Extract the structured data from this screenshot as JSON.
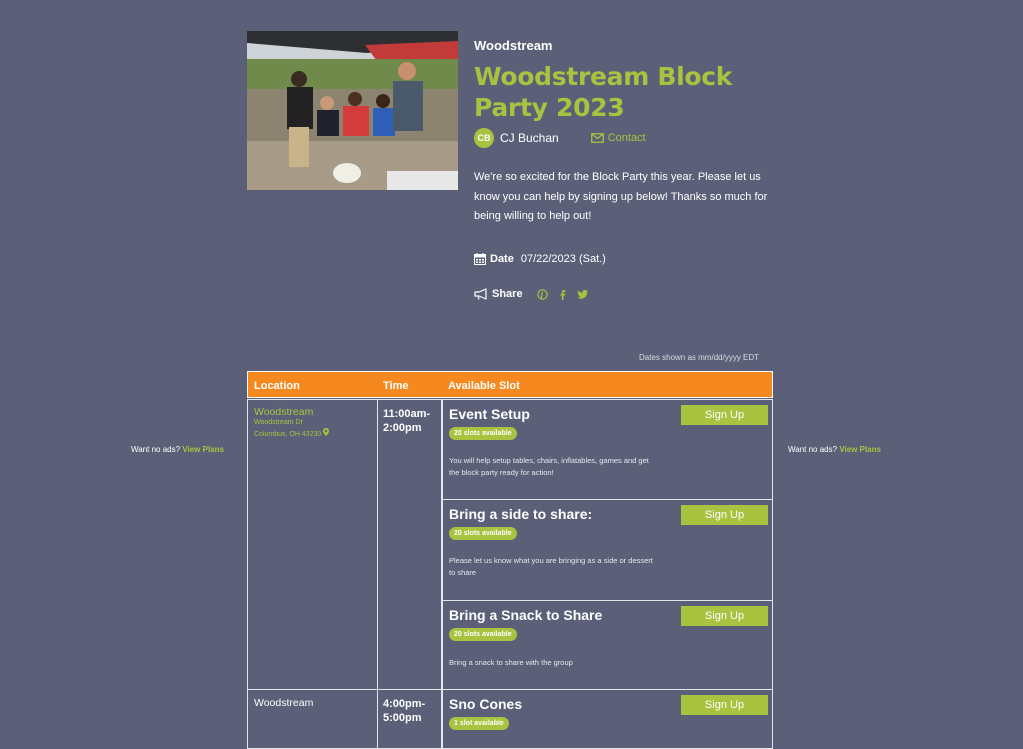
{
  "event": {
    "org": "Woodstream",
    "title": "Woodstream Block Party 2023",
    "organizer_initials": "CB",
    "organizer_name": "CJ Buchan",
    "contact_label": "Contact",
    "description": "We're so excited for the Block Party this year. Please let us know you can help by signing up below! Thanks so much for being willing to help out!",
    "date_label": "Date",
    "date_value": "07/22/2023 (Sat.)",
    "share_label": "Share",
    "share_icons": [
      "pinterest-icon",
      "facebook-icon",
      "twitter-icon"
    ]
  },
  "dates_note": "Dates shown as mm/dd/yyyy EDT",
  "ads": {
    "text": "Want no ads?",
    "link": "View Plans"
  },
  "table": {
    "headers": {
      "location": "Location",
      "time": "Time",
      "slot": "Available Slot"
    },
    "groups": [
      {
        "location": "Woodstream",
        "address1": "Woodstream Dr",
        "address2": "Columbus, OH 43230",
        "time": "11:00am-2:00pm",
        "slots": [
          {
            "title": "Event Setup",
            "badge": "20 slots available",
            "desc": "You will help setup tables, chairs, inflatables, games and get the block party ready for action!",
            "button": "Sign Up"
          },
          {
            "title": "Bring a side to share:",
            "badge": "20 slots available",
            "desc": "Please let us know what you are bringing as a side or dessert to share",
            "button": "Sign Up"
          },
          {
            "title": "Bring a Snack to Share",
            "badge": "20 slots available",
            "desc": "Bring a snack to share with the group",
            "button": "Sign Up"
          }
        ]
      },
      {
        "location": "Woodstream",
        "time": "4:00pm-5:00pm",
        "slots": [
          {
            "title": "Sno Cones",
            "badge": "1 slot available",
            "button": "Sign Up"
          }
        ]
      }
    ]
  },
  "colors": {
    "background": "#5b6078",
    "accent": "#a9c23f",
    "header": "#f5891f"
  }
}
